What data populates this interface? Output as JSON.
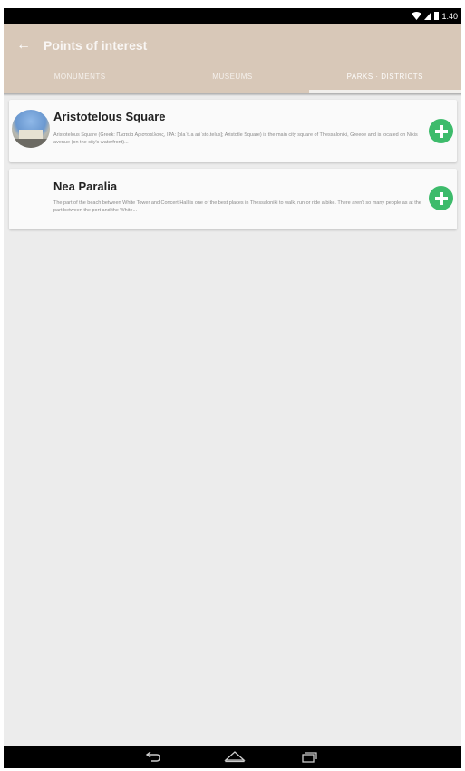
{
  "status_bar": {
    "time": "1:40"
  },
  "app_bar": {
    "title": "Points of interest"
  },
  "tabs": [
    {
      "label": "MONUMENTS"
    },
    {
      "label": "MUSEUMS"
    },
    {
      "label": "PARKS · DISTRICTS"
    }
  ],
  "cards": [
    {
      "title": "Aristotelous Square",
      "text": "Aristotelous Square (Greek: Πλατεία Αριστοτέλους, IPA: [plaˈti.a ariˈsto.telus]; Aristotle Square) is the main city square of Thessaloniki, Greece and is located on Nikis avenue (on the city's waterfront)..."
    },
    {
      "title": "Nea Paralia",
      "text": "The part of the beach between White Tower and Concert Hall is one of the best places in Thessaloniki to walk, run or ride a bike. There aren't so many people as at the part between the port and the White..."
    }
  ],
  "icons": {
    "back": "arrow-left-icon",
    "add": "plus-circle-icon",
    "nav_back": "nav-back-icon",
    "nav_home": "nav-home-icon",
    "nav_recents": "nav-recents-icon"
  },
  "colors": {
    "app_bar": "#d8c8b8",
    "add_button": "#3dbb6b",
    "background": "#ececec"
  }
}
